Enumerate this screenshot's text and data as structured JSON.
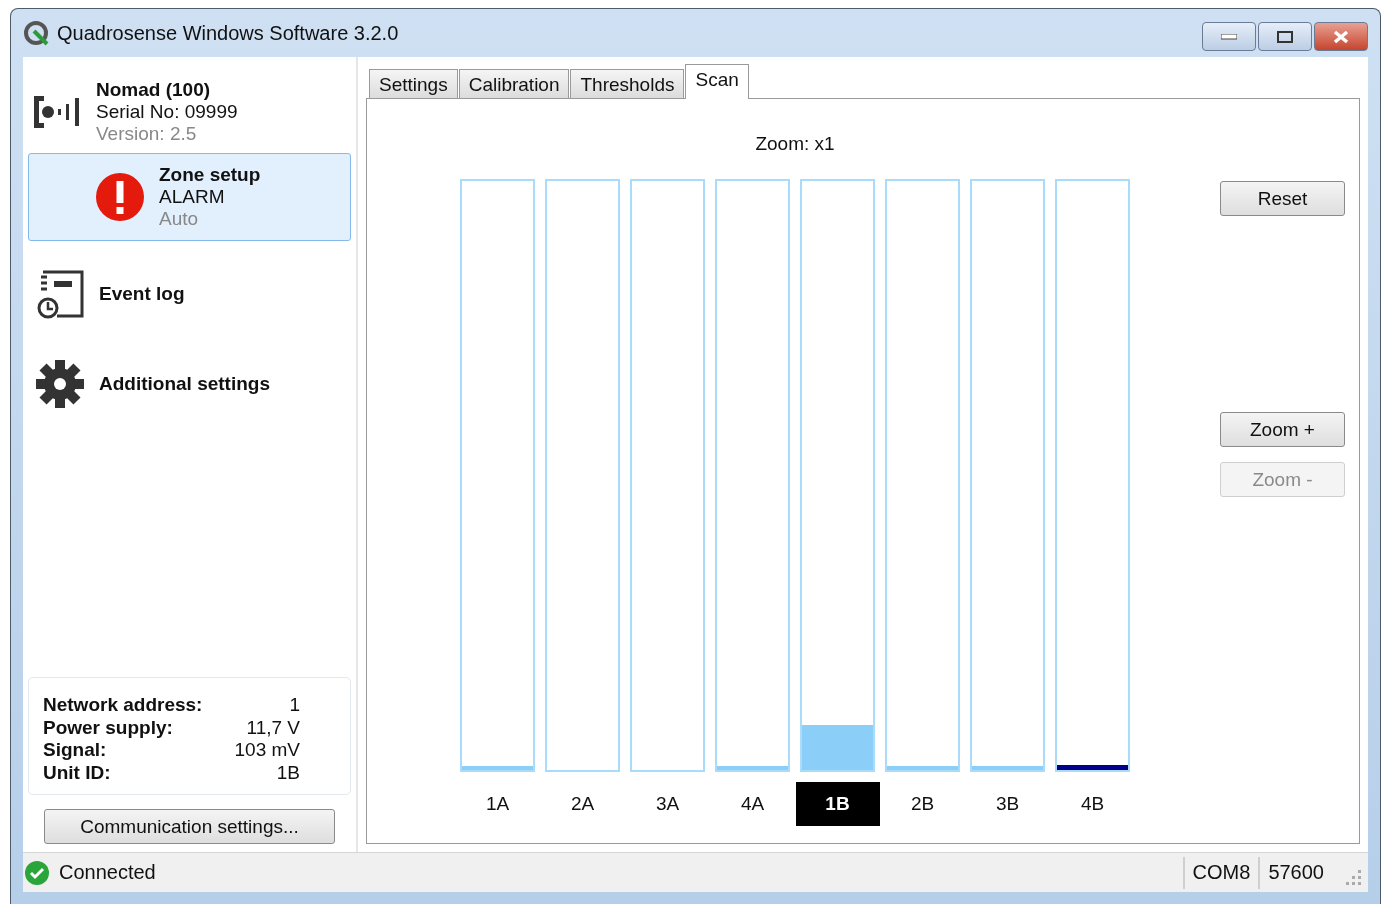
{
  "window": {
    "title": "Quadrosense Windows Software 3.2.0"
  },
  "device": {
    "name": "Nomad (100)",
    "serial": "Serial No: 09999",
    "version": "Version: 2.5"
  },
  "nav": [
    {
      "kind": "alarm",
      "title": "Zone setup",
      "status": "ALARM",
      "mode": "Auto",
      "selected": true
    },
    {
      "kind": "log",
      "title": "Event log",
      "selected": false
    },
    {
      "kind": "gear",
      "title": "Additional settings",
      "selected": false
    }
  ],
  "info": [
    {
      "label": "Network address:",
      "value": "1"
    },
    {
      "label": "Power supply:",
      "value": "11,7 V"
    },
    {
      "label": "Signal:",
      "value": "103 mV"
    },
    {
      "label": "Unit ID:",
      "value": "1B"
    }
  ],
  "communication_button": "Communication settings...",
  "tabs": [
    {
      "label": "Settings",
      "selected": false
    },
    {
      "label": "Calibration",
      "selected": false
    },
    {
      "label": "Thresholds",
      "selected": false
    },
    {
      "label": "Scan",
      "selected": true
    }
  ],
  "zoom_label": "Zoom: x1",
  "channels": [
    {
      "name": "1A",
      "level": 0.007,
      "color": "#8bcff9",
      "selected": false
    },
    {
      "name": "2A",
      "selected": false
    },
    {
      "name": "3A",
      "selected": false
    },
    {
      "name": "4A",
      "level": 0.007,
      "color": "#8bcff9",
      "selected": false
    },
    {
      "name": "1B",
      "level": 0.076,
      "color": "#8bcff9",
      "selected": true
    },
    {
      "name": "2B",
      "level": 0.007,
      "color": "#8bcff9",
      "selected": false
    },
    {
      "name": "3B",
      "level": 0.007,
      "color": "#8bcff9",
      "selected": false
    },
    {
      "name": "4B",
      "level": 0.008,
      "color": "#00008b",
      "selected": false
    }
  ],
  "buttons": [
    {
      "label": "Reset",
      "disabled": false
    },
    {
      "label": "Zoom +",
      "disabled": false
    },
    {
      "label": "Zoom -",
      "disabled": true
    }
  ],
  "status_bar": {
    "connection": "Connected",
    "port": "COM8",
    "baud": "57600"
  }
}
